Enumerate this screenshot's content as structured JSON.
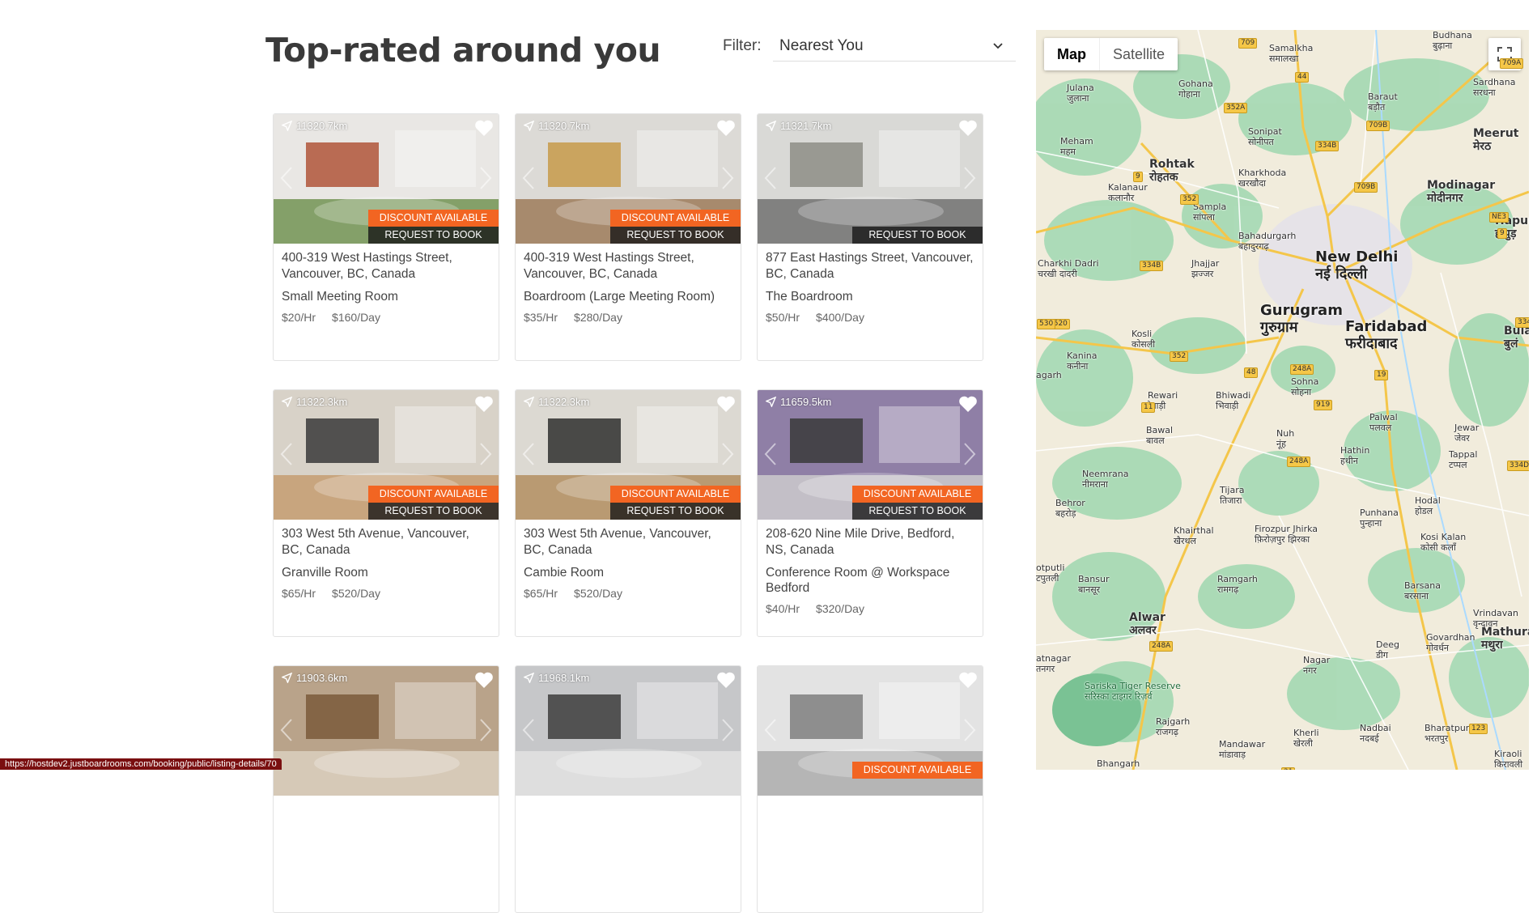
{
  "header": {
    "title": "Top-rated around you"
  },
  "filter": {
    "label": "Filter:",
    "value": "Nearest You"
  },
  "listings": [
    {
      "distance": "11320.7km",
      "address": "400-319 West Hastings Street, Vancouver, BC, Canada",
      "room": "Small Meeting Room",
      "price_hr": "$20/Hr",
      "price_day": "$160/Day",
      "discount": "DISCOUNT AVAILABLE",
      "request": "REQUEST TO BOOK"
    },
    {
      "distance": "11320.7km",
      "address": "400-319 West Hastings Street, Vancouver, BC, Canada",
      "room": "Boardroom (Large Meeting Room)",
      "price_hr": "$35/Hr",
      "price_day": "$280/Day",
      "discount": "DISCOUNT AVAILABLE",
      "request": "REQUEST TO BOOK"
    },
    {
      "distance": "11321.7km",
      "address": "877 East Hastings Street, Vancouver, BC, Canada",
      "room": "The Boardroom",
      "price_hr": "$50/Hr",
      "price_day": "$400/Day",
      "discount": "",
      "request": "REQUEST TO BOOK"
    },
    {
      "distance": "11322.3km",
      "address": "303 West 5th Avenue, Vancouver, BC, Canada",
      "room": "Granville Room",
      "price_hr": "$65/Hr",
      "price_day": "$520/Day",
      "discount": "DISCOUNT AVAILABLE",
      "request": "REQUEST TO BOOK"
    },
    {
      "distance": "11322.3km",
      "address": "303 West 5th Avenue, Vancouver, BC, Canada",
      "room": "Cambie Room",
      "price_hr": "$65/Hr",
      "price_day": "$520/Day",
      "discount": "DISCOUNT AVAILABLE",
      "request": "REQUEST TO BOOK"
    },
    {
      "distance": "11659.5km",
      "address": "208-620 Nine Mile Drive, Bedford, NS, Canada",
      "room": "Conference Room @ Workspace Bedford",
      "price_hr": "$40/Hr",
      "price_day": "$320/Day",
      "discount": "DISCOUNT AVAILABLE",
      "request": "REQUEST TO BOOK"
    },
    {
      "distance": "11903.6km",
      "discount": ""
    },
    {
      "distance": "11968.1km",
      "discount": ""
    },
    {
      "distance": "",
      "discount": "DISCOUNT AVAILABLE"
    }
  ],
  "map": {
    "toggle_map": "Map",
    "toggle_satellite": "Satellite",
    "places": {
      "new_delhi": "New Delhi",
      "new_delhi_hi": "नई दिल्ली",
      "gurugram": "Gurugram",
      "gurugram_hi": "गुरुग्राम",
      "faridabad": "Faridabad",
      "faridabad_hi": "फरीदाबाद",
      "rohtak": "Rohtak",
      "rohtak_hi": "रोहतक",
      "alwar": "Alwar",
      "alwar_hi": "अलवर",
      "mathura": "Mathura",
      "mathura_hi": "मथुरा",
      "meerut": "Meerut",
      "meerut_hi": "मेरठ",
      "modinagar": "Modinagar",
      "modinagar_hi": "मोदीनगर",
      "hapur": "Hapur",
      "hapur_hi": "हापुड़",
      "baraut": "Baraut",
      "baraut_hi": "बड़ौत",
      "sonipat": "Sonipat",
      "sonipat_hi": "सोनीपत",
      "budhana": "Budhana",
      "budhana_hi": "बुढ़ाना",
      "samalkha": "Samalkha",
      "samalkha_hi": "समालखा",
      "gohana": "Gohana",
      "gohana_hi": "गोहाना",
      "julana": "Julana",
      "julana_hi": "जुलाना",
      "meham": "Meham",
      "meham_hi": "महम",
      "sardhana": "Sardhana",
      "sardhana_hi": "सरधना",
      "kharkhoda": "Kharkhoda",
      "kharkhoda_hi": "खरखौदा",
      "kalanaur": "Kalanaur",
      "kalanaur_hi": "कलानौर",
      "sampla": "Sampla",
      "sampla_hi": "सांपला",
      "bahadurgarh": "Bahadurgarh",
      "bahadurgarh_hi": "बहादुरगढ़",
      "charkhi_dadri": "Charkhi Dadri",
      "charkhi_dadri_hi": "चरखी दादरी",
      "jhajjar": "Jhajjar",
      "jhajjar_hi": "झज्जर",
      "kosli": "Kosli",
      "kosli_hi": "कोसली",
      "kanina": "Kanina",
      "kanina_hi": "कनीना",
      "rewari": "Rewari",
      "rewari_hi": "रेवाड़ी",
      "bhiwadi": "Bhiwadi",
      "bhiwadi_hi": "भिवाड़ी",
      "sohna": "Sohna",
      "sohna_hi": "सोहना",
      "bawal": "Bawal",
      "bawal_hi": "बावल",
      "nuh": "Nuh",
      "nuh_hi": "नूंह",
      "palwal": "Palwal",
      "palwal_hi": "पलवल",
      "hathin": "Hathin",
      "hathin_hi": "हथीन",
      "jewar": "Jewar",
      "jewar_hi": "जेवर",
      "tappal": "Tappal",
      "tappal_hi": "टप्पल",
      "neemrana": "Neemrana",
      "neemrana_hi": "नीमराना",
      "tijara": "Tijara",
      "tijara_hi": "तिजारा",
      "behror": "Behror",
      "behror_hi": "बहरोड़",
      "khairthal": "Khairthal",
      "khairthal_hi": "खैरथल",
      "firozpur_jhirka": "Firozpur Jhirka",
      "firozpur_jhirka_hi": "फ़िरोज़पुर झिरका",
      "punhana": "Punhana",
      "punhana_hi": "पुन्हाना",
      "hodal": "Hodal",
      "hodal_hi": "होडल",
      "kosi_kalan": "Kosi Kalan",
      "kosi_kalan_hi": "कोसी कलाँ",
      "bansur": "Bansur",
      "bansur_hi": "बानसूर",
      "ramgarh": "Ramgarh",
      "ramgarh_hi": "रामगढ़",
      "barsana": "Barsana",
      "barsana_hi": "बरसाना",
      "vrindavan": "Vrindavan",
      "vrindavan_hi": "वृन्दावन",
      "govardhan": "Govardhan",
      "govardhan_hi": "गोवर्धन",
      "deeg": "Deeg",
      "deeg_hi": "डीग",
      "nagar": "Nagar",
      "nagar_hi": "नगर",
      "sariska": "Sariska Tiger Reserve",
      "sariska_hi": "सरिस्का टाइगर रिज़र्व",
      "rajgarh": "Rajgarh",
      "rajgarh_hi": "राजगढ़",
      "kherli": "Kherli",
      "kherli_hi": "खेरली",
      "nadbai": "Nadbai",
      "nadbai_hi": "नदबई",
      "bharatpur": "Bharatpur",
      "bharatpur_hi": "भरतपुर",
      "mandawar": "Mandawar",
      "mandawar_hi": "मांडावाड़",
      "bhangarh": "Bhangarh",
      "kiraoli": "Kiraoli",
      "kiraoli_hi": "किरावली",
      "bulan": "Bulan",
      "bulan_hi": "बुलं",
      "kotputli": "otputli",
      "kotputli_hi": "टपुतली",
      "agarh": "agarh",
      "atnagar": "atnagar",
      "atnagar_hi": "तनगर"
    },
    "roads": [
      "709",
      "44",
      "352A",
      "334B",
      "709B",
      "709A",
      "9",
      "352",
      "334B",
      "1520",
      "352",
      "48",
      "248A",
      "11",
      "248A",
      "919",
      "19",
      "334",
      "334D",
      "NE3",
      "9",
      "709B",
      "248A",
      "19",
      "123",
      "21",
      "530"
    ]
  },
  "status_bar": {
    "url": "https://hostdev2.justboardrooms.com/booking/public/listing-details/70"
  }
}
